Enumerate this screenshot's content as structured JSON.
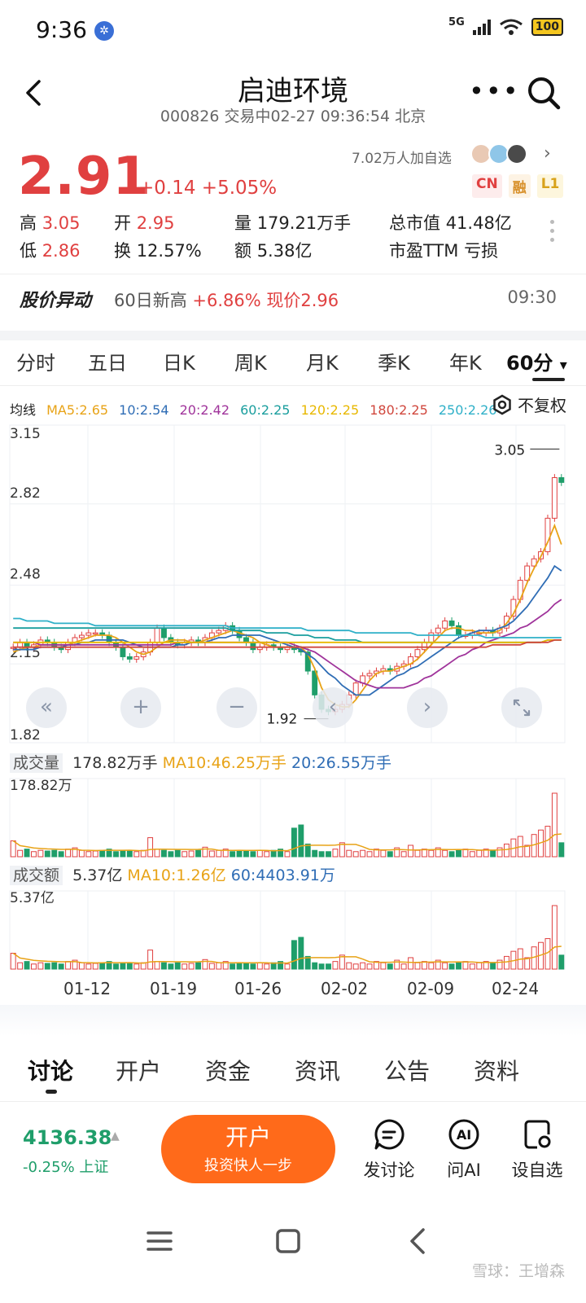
{
  "status_bar": {
    "time": "9:36",
    "network": "5G",
    "battery": "100"
  },
  "nav": {
    "title": "启迪环境",
    "subtitle": "000826 交易中02-27 09:36:54 北京",
    "more": "•••"
  },
  "quote": {
    "price": "2.91",
    "change": "+0.14 +5.05%",
    "followers": "7.02万人加自选",
    "tags": [
      "CN",
      "融",
      "L1"
    ],
    "stats": [
      {
        "label": "高",
        "value": "3.05",
        "tone": "red"
      },
      {
        "label": "开",
        "value": "2.95",
        "tone": "red"
      },
      {
        "label": "量",
        "value": "179.21万手",
        "tone": "plain"
      },
      {
        "label": "总市值",
        "value": "41.48亿",
        "tone": "plain"
      },
      {
        "label": "低",
        "value": "2.86",
        "tone": "red"
      },
      {
        "label": "换",
        "value": "12.57%",
        "tone": "plain"
      },
      {
        "label": "额",
        "value": "5.38亿",
        "tone": "plain"
      },
      {
        "label": "市盈TTM",
        "value": "亏损",
        "tone": "plain"
      }
    ]
  },
  "alert": {
    "title": "股价异动",
    "text_prefix": "60日新高 ",
    "text_highlight": "+6.86% 现价2.96",
    "time": "09:30"
  },
  "chart_tabs": [
    "分时",
    "五日",
    "日K",
    "周K",
    "月K",
    "季K",
    "年K",
    "60分"
  ],
  "chart_tab_dropdown": "▾",
  "ma_legend": [
    {
      "text": "均线",
      "color": "#222222"
    },
    {
      "text": "MA5:2.65",
      "color": "#e8a317"
    },
    {
      "text": "10:2.54",
      "color": "#2f6db5"
    },
    {
      "text": "20:2.42",
      "color": "#a0349b"
    },
    {
      "text": "60:2.25",
      "color": "#1a9e9e"
    },
    {
      "text": "120:2.25",
      "color": "#e8b800"
    },
    {
      "text": "180:2.25",
      "color": "#d0473d"
    },
    {
      "text": "250:2.26",
      "color": "#2fb0c8"
    }
  ],
  "fq_label": "不复权",
  "volume": {
    "label": "成交量",
    "value": "178.82万手",
    "ma10": "MA10:46.25万手",
    "ma20": "20:26.55万手",
    "max": "178.82万"
  },
  "amount": {
    "label": "成交额",
    "value": "5.37亿",
    "ma10": "MA10:1.26亿",
    "ma60": "60:4403.91万",
    "max": "5.37亿"
  },
  "date_axis": [
    "01-12",
    "01-19",
    "01-26",
    "02-02",
    "02-09",
    "02-24"
  ],
  "chart_controls": [
    "«",
    "+",
    "−",
    "‹",
    "›"
  ],
  "chart_data": {
    "type": "candlestick",
    "ylim": [
      1.82,
      3.15
    ],
    "y_ticks": [
      "3.15",
      "2.82",
      "2.48",
      "2.15",
      "1.82"
    ],
    "annot_high": "3.05",
    "annot_low": "1.92",
    "close": [
      2.22,
      2.24,
      2.22,
      2.23,
      2.25,
      2.24,
      2.22,
      2.21,
      2.24,
      2.26,
      2.27,
      2.28,
      2.28,
      2.27,
      2.24,
      2.22,
      2.18,
      2.17,
      2.18,
      2.2,
      2.24,
      2.3,
      2.26,
      2.24,
      2.23,
      2.24,
      2.25,
      2.24,
      2.26,
      2.28,
      2.29,
      2.31,
      2.29,
      2.26,
      2.24,
      2.21,
      2.22,
      2.23,
      2.22,
      2.21,
      2.22,
      2.21,
      2.2,
      2.12,
      2.02,
      1.96,
      1.95,
      1.96,
      1.98,
      2.02,
      2.07,
      2.1,
      2.11,
      2.12,
      2.13,
      2.12,
      2.14,
      2.15,
      2.18,
      2.21,
      2.24,
      2.28,
      2.3,
      2.33,
      2.31,
      2.27,
      2.27,
      2.28,
      2.28,
      2.29,
      2.28,
      2.3,
      2.35,
      2.42,
      2.5,
      2.56,
      2.59,
      2.62,
      2.76,
      2.93,
      2.91
    ],
    "volume_rel": [
      0.25,
      0.1,
      0.12,
      0.08,
      0.1,
      0.09,
      0.1,
      0.08,
      0.12,
      0.14,
      0.1,
      0.08,
      0.09,
      0.1,
      0.12,
      0.08,
      0.1,
      0.09,
      0.08,
      0.1,
      0.3,
      0.12,
      0.1,
      0.08,
      0.1,
      0.08,
      0.09,
      0.1,
      0.15,
      0.09,
      0.1,
      0.12,
      0.08,
      0.1,
      0.09,
      0.08,
      0.1,
      0.08,
      0.1,
      0.12,
      0.08,
      0.45,
      0.5,
      0.2,
      0.1,
      0.08,
      0.08,
      0.12,
      0.22,
      0.1,
      0.08,
      0.1,
      0.08,
      0.12,
      0.1,
      0.08,
      0.14,
      0.08,
      0.18,
      0.1,
      0.12,
      0.1,
      0.14,
      0.1,
      0.08,
      0.1,
      0.12,
      0.08,
      0.1,
      0.12,
      0.1,
      0.14,
      0.2,
      0.28,
      0.32,
      0.18,
      0.35,
      0.42,
      0.48,
      1.0,
      0.22
    ],
    "up_color": "#e04040",
    "down_color": "#1f9e6a",
    "ma_lines": [
      {
        "name": "MA5",
        "color": "#e8a317",
        "values": [
          2.2,
          2.21,
          2.22,
          2.22,
          2.23,
          2.23,
          2.23,
          2.23,
          2.23,
          2.24,
          2.25,
          2.26,
          2.27,
          2.27,
          2.27,
          2.26,
          2.24,
          2.22,
          2.2,
          2.19,
          2.2,
          2.22,
          2.24,
          2.25,
          2.25,
          2.25,
          2.24,
          2.24,
          2.25,
          2.26,
          2.27,
          2.28,
          2.29,
          2.28,
          2.27,
          2.26,
          2.24,
          2.23,
          2.22,
          2.22,
          2.22,
          2.22,
          2.22,
          2.19,
          2.13,
          2.05,
          2.0,
          1.98,
          1.97,
          1.97,
          2.0,
          2.04,
          2.08,
          2.11,
          2.12,
          2.12,
          2.13,
          2.14,
          2.15,
          2.17,
          2.2,
          2.23,
          2.26,
          2.29,
          2.3,
          2.3,
          2.29,
          2.29,
          2.28,
          2.28,
          2.28,
          2.29,
          2.32,
          2.36,
          2.42,
          2.49,
          2.55,
          2.6,
          2.66,
          2.73,
          2.65
        ]
      },
      {
        "name": "MA10",
        "color": "#2f6db5",
        "values": [
          2.21,
          2.21,
          2.21,
          2.21,
          2.22,
          2.22,
          2.22,
          2.22,
          2.23,
          2.23,
          2.24,
          2.24,
          2.25,
          2.25,
          2.25,
          2.25,
          2.25,
          2.24,
          2.23,
          2.22,
          2.22,
          2.22,
          2.22,
          2.22,
          2.23,
          2.23,
          2.24,
          2.24,
          2.24,
          2.25,
          2.26,
          2.26,
          2.27,
          2.27,
          2.27,
          2.27,
          2.27,
          2.26,
          2.25,
          2.24,
          2.23,
          2.22,
          2.21,
          2.19,
          2.17,
          2.14,
          2.11,
          2.09,
          2.06,
          2.04,
          2.02,
          2.02,
          2.02,
          2.04,
          2.06,
          2.08,
          2.1,
          2.11,
          2.13,
          2.14,
          2.16,
          2.18,
          2.2,
          2.22,
          2.24,
          2.26,
          2.27,
          2.28,
          2.29,
          2.29,
          2.29,
          2.3,
          2.31,
          2.33,
          2.36,
          2.39,
          2.43,
          2.47,
          2.51,
          2.56,
          2.54
        ]
      },
      {
        "name": "MA20",
        "color": "#a0349b",
        "values": [
          2.24,
          2.24,
          2.24,
          2.24,
          2.23,
          2.23,
          2.23,
          2.23,
          2.23,
          2.23,
          2.23,
          2.23,
          2.23,
          2.23,
          2.23,
          2.23,
          2.23,
          2.23,
          2.23,
          2.23,
          2.23,
          2.23,
          2.23,
          2.23,
          2.24,
          2.24,
          2.24,
          2.24,
          2.24,
          2.24,
          2.24,
          2.24,
          2.24,
          2.24,
          2.24,
          2.24,
          2.24,
          2.24,
          2.24,
          2.24,
          2.24,
          2.23,
          2.22,
          2.21,
          2.2,
          2.18,
          2.16,
          2.14,
          2.12,
          2.1,
          2.08,
          2.07,
          2.06,
          2.05,
          2.05,
          2.05,
          2.05,
          2.05,
          2.06,
          2.07,
          2.09,
          2.1,
          2.12,
          2.14,
          2.16,
          2.18,
          2.19,
          2.21,
          2.22,
          2.24,
          2.25,
          2.26,
          2.27,
          2.28,
          2.3,
          2.31,
          2.33,
          2.35,
          2.37,
          2.4,
          2.42
        ]
      },
      {
        "name": "MA60",
        "color": "#1a9e9e",
        "values": [
          2.3,
          2.3,
          2.3,
          2.3,
          2.3,
          2.3,
          2.3,
          2.3,
          2.3,
          2.3,
          2.3,
          2.3,
          2.3,
          2.3,
          2.3,
          2.3,
          2.3,
          2.3,
          2.3,
          2.3,
          2.3,
          2.3,
          2.3,
          2.3,
          2.3,
          2.3,
          2.3,
          2.3,
          2.3,
          2.3,
          2.3,
          2.3,
          2.29,
          2.29,
          2.29,
          2.29,
          2.29,
          2.28,
          2.28,
          2.28,
          2.28,
          2.27,
          2.27,
          2.27,
          2.26,
          2.26,
          2.26,
          2.25,
          2.25,
          2.25,
          2.25,
          2.24,
          2.24,
          2.24,
          2.24,
          2.24,
          2.24,
          2.24,
          2.24,
          2.24,
          2.24,
          2.24,
          2.24,
          2.24,
          2.24,
          2.24,
          2.24,
          2.24,
          2.24,
          2.24,
          2.24,
          2.24,
          2.24,
          2.24,
          2.24,
          2.24,
          2.24,
          2.24,
          2.25,
          2.25,
          2.25
        ]
      },
      {
        "name": "MA120",
        "color": "#e8b800",
        "values": [
          2.24,
          2.24,
          2.24,
          2.24,
          2.24,
          2.24,
          2.24,
          2.24,
          2.24,
          2.24,
          2.24,
          2.24,
          2.24,
          2.24,
          2.24,
          2.24,
          2.24,
          2.24,
          2.24,
          2.24,
          2.24,
          2.24,
          2.24,
          2.24,
          2.24,
          2.24,
          2.24,
          2.24,
          2.24,
          2.24,
          2.24,
          2.24,
          2.24,
          2.24,
          2.24,
          2.24,
          2.24,
          2.24,
          2.24,
          2.24,
          2.24,
          2.24,
          2.24,
          2.24,
          2.24,
          2.24,
          2.24,
          2.24,
          2.24,
          2.24,
          2.24,
          2.24,
          2.24,
          2.24,
          2.24,
          2.24,
          2.24,
          2.24,
          2.24,
          2.24,
          2.24,
          2.24,
          2.24,
          2.24,
          2.24,
          2.24,
          2.24,
          2.24,
          2.24,
          2.24,
          2.24,
          2.24,
          2.24,
          2.24,
          2.24,
          2.24,
          2.24,
          2.24,
          2.25,
          2.25,
          2.25
        ]
      },
      {
        "name": "MA180",
        "color": "#d0473d",
        "values": [
          2.22,
          2.22,
          2.22,
          2.22,
          2.22,
          2.22,
          2.22,
          2.22,
          2.22,
          2.22,
          2.22,
          2.22,
          2.22,
          2.22,
          2.22,
          2.22,
          2.22,
          2.22,
          2.22,
          2.22,
          2.22,
          2.22,
          2.22,
          2.22,
          2.22,
          2.22,
          2.22,
          2.22,
          2.22,
          2.22,
          2.22,
          2.22,
          2.22,
          2.22,
          2.22,
          2.22,
          2.22,
          2.22,
          2.22,
          2.22,
          2.22,
          2.22,
          2.22,
          2.22,
          2.22,
          2.22,
          2.22,
          2.22,
          2.22,
          2.22,
          2.22,
          2.22,
          2.22,
          2.22,
          2.22,
          2.22,
          2.22,
          2.22,
          2.22,
          2.22,
          2.22,
          2.22,
          2.22,
          2.22,
          2.22,
          2.22,
          2.22,
          2.22,
          2.22,
          2.22,
          2.23,
          2.23,
          2.23,
          2.23,
          2.23,
          2.24,
          2.24,
          2.24,
          2.24,
          2.25,
          2.25
        ]
      },
      {
        "name": "MA250",
        "color": "#2fb0c8",
        "values": [
          2.34,
          2.34,
          2.33,
          2.33,
          2.33,
          2.33,
          2.32,
          2.32,
          2.32,
          2.32,
          2.32,
          2.32,
          2.31,
          2.31,
          2.31,
          2.31,
          2.31,
          2.31,
          2.31,
          2.31,
          2.31,
          2.31,
          2.31,
          2.31,
          2.31,
          2.31,
          2.31,
          2.31,
          2.31,
          2.31,
          2.31,
          2.31,
          2.3,
          2.3,
          2.3,
          2.3,
          2.3,
          2.3,
          2.3,
          2.3,
          2.3,
          2.3,
          2.3,
          2.29,
          2.29,
          2.29,
          2.29,
          2.29,
          2.29,
          2.29,
          2.28,
          2.28,
          2.28,
          2.28,
          2.28,
          2.28,
          2.28,
          2.28,
          2.28,
          2.27,
          2.27,
          2.27,
          2.27,
          2.27,
          2.27,
          2.27,
          2.27,
          2.27,
          2.27,
          2.26,
          2.26,
          2.26,
          2.26,
          2.26,
          2.26,
          2.26,
          2.26,
          2.26,
          2.26,
          2.26,
          2.26
        ]
      }
    ]
  },
  "bottom_tabs": [
    "讨论",
    "开户",
    "资金",
    "资讯",
    "公告",
    "资料"
  ],
  "footer": {
    "index_value": "4136.38",
    "index_arrow": "▲",
    "index_change": "-0.25% 上证",
    "open_title": "开户",
    "open_sub": "投资快人一步",
    "actions": [
      "发讨论",
      "问AI",
      "设自选"
    ]
  },
  "watermark": "雪球：王增森"
}
